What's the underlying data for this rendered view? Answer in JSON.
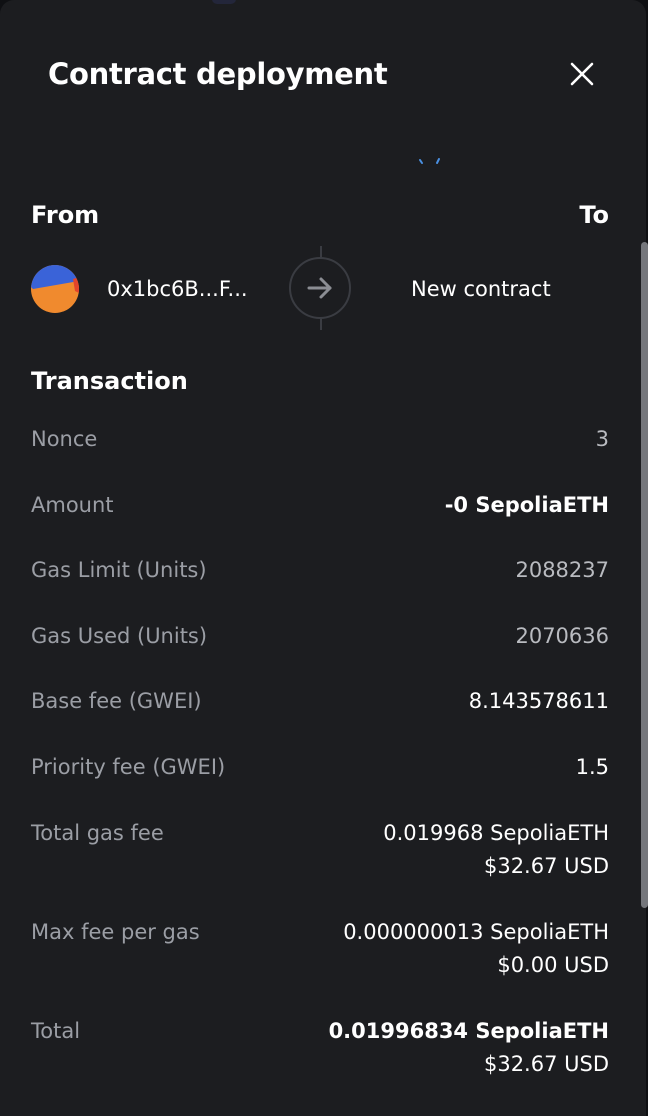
{
  "header": {
    "title": "Contract deployment",
    "close_icon": "close-icon"
  },
  "parties": {
    "from_label": "From",
    "to_label": "To",
    "from_address": "0x1bc6B...F...",
    "to_value": "New contract",
    "avatar_colors": [
      "#3a63d8",
      "#f08a2e",
      "#e2452b"
    ]
  },
  "transaction": {
    "title": "Transaction",
    "rows": [
      {
        "label": "Nonce",
        "value": "3"
      },
      {
        "label": "Amount",
        "value": "-0 SepoliaETH"
      },
      {
        "label": "Gas Limit (Units)",
        "value": "2088237"
      },
      {
        "label": "Gas Used (Units)",
        "value": "2070636"
      },
      {
        "label": "Base fee (GWEI)",
        "value": "8.143578611"
      },
      {
        "label": "Priority fee (GWEI)",
        "value": "1.5"
      },
      {
        "label": "Total gas fee",
        "value": "0.019968 SepoliaETH",
        "subvalue": "$32.67 USD"
      },
      {
        "label": "Max fee per gas",
        "value": "0.000000013 SepoliaETH",
        "subvalue": "$0.00 USD"
      },
      {
        "label": "Total",
        "value": "0.01996834 SepoliaETH",
        "subvalue": "$32.67 USD"
      }
    ]
  },
  "colors": {
    "background": "#1c1d20",
    "label": "#9b9ea5",
    "value": "#b9bbc0",
    "accent": "#4a90e2"
  }
}
